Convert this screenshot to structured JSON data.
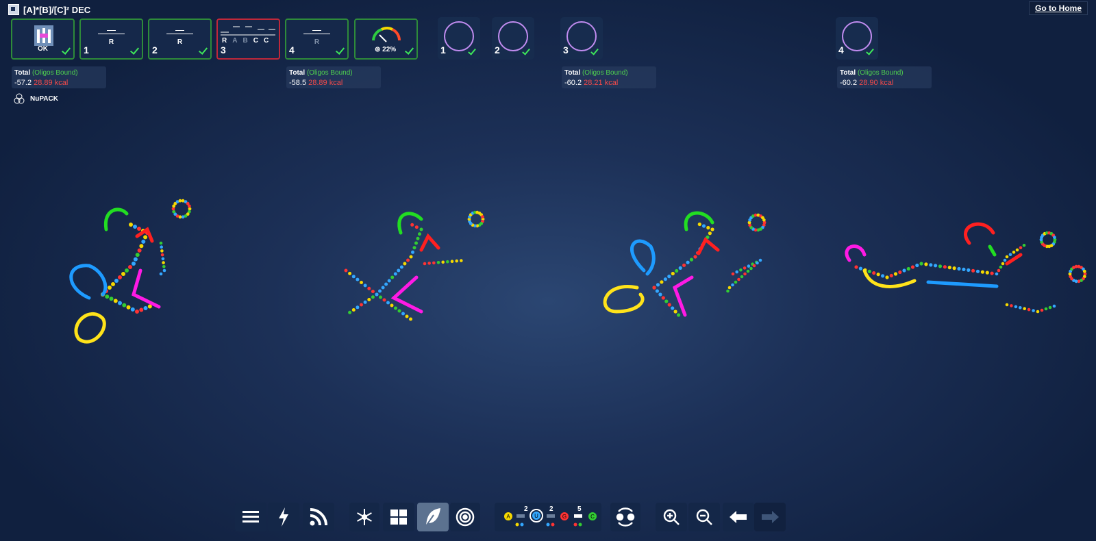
{
  "window": {
    "title": "[A]*[B]/[C]² DEC",
    "home_label": "Go to Home"
  },
  "targets": [
    {
      "id": "ok",
      "label": "OK",
      "status": "satisfied"
    },
    {
      "id": "1",
      "num": "1",
      "sub": "R",
      "status": "satisfied"
    },
    {
      "id": "2",
      "num": "2",
      "sub": "R",
      "status": "satisfied"
    },
    {
      "id": "3",
      "num": "3",
      "seq": [
        "R",
        "A",
        "B",
        "C",
        "C"
      ],
      "status": "failed"
    },
    {
      "id": "4",
      "num": "4",
      "sub": "R",
      "status": "satisfied"
    },
    {
      "id": "gauge",
      "label": "⊚ 22%",
      "value_pct": 22,
      "status": "satisfied"
    }
  ],
  "states": [
    {
      "num": "1",
      "ring_color": "#c18cf0",
      "total_label": "Total",
      "oligos_label": "(Oligos Bound)",
      "energy": "-57.2",
      "kcal": "28.89 kcal"
    },
    {
      "num": "2",
      "ring_color": "#c18cf0",
      "total_label": "Total",
      "oligos_label": "(Oligos Bound)",
      "energy": "-58.5",
      "kcal": "28.89 kcal"
    },
    {
      "num": "3",
      "ring_color": "#c18cf0",
      "total_label": "Total",
      "oligos_label": "(Oligos Bound)",
      "energy": "-60.2",
      "kcal": "28.21 kcal"
    },
    {
      "num": "4",
      "ring_color": "#c18cf0",
      "total_label": "Total",
      "oligos_label": "(Oligos Bound)",
      "energy": "-60.2",
      "kcal": "28.90 kcal"
    }
  ],
  "engine": {
    "label": "NuPACK"
  },
  "palette": {
    "bases": [
      "A",
      "U",
      "G",
      "C"
    ],
    "pair_counts": [
      "2",
      "2",
      "5"
    ],
    "colors": {
      "A": "#f5d800",
      "U": "#33a7ff",
      "G": "#ff3333",
      "C": "#33cc33"
    }
  },
  "toolbar": {
    "buttons": [
      "menu-icon",
      "lightning-icon",
      "rss-icon",
      "snowflake-icon",
      "grid-icon",
      "leaf-icon",
      "target-icon",
      "swap-icon",
      "zoom-in-icon",
      "zoom-out-icon",
      "undo-icon",
      "redo-icon"
    ],
    "selected": "leaf-icon"
  },
  "colors": {
    "ok": "#2e8b3a",
    "fail": "#c0283a",
    "energy_red": "#f24a4a",
    "oligo_green": "#4fd04f",
    "ring": "#c18cf0",
    "strand_yellow": "#ffe31a",
    "strand_blue": "#1e9bff",
    "strand_magenta": "#ff1ae5",
    "strand_red": "#ff2020",
    "strand_green": "#22dd22"
  }
}
